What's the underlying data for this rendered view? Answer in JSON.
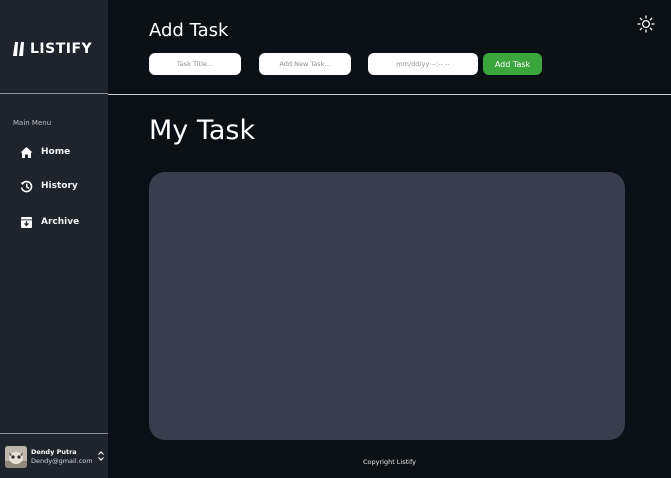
{
  "app": {
    "logo_text": "LISTIFY",
    "logo_mark_icon": "listify-quote-icon"
  },
  "sidebar": {
    "heading": "Main Menu",
    "items": [
      {
        "label": "Home",
        "icon": "home-icon"
      },
      {
        "label": "History",
        "icon": "history-icon"
      },
      {
        "label": "Archive",
        "icon": "archive-icon"
      }
    ]
  },
  "user": {
    "name": "Dendy Putra",
    "email": "Dendy@gmail.com",
    "toggle_icon": "chevron-up-down-icon"
  },
  "header": {
    "title": "Add Task",
    "theme_icon": "sun-icon",
    "task_title_placeholder": "Task Title...",
    "new_task_placeholder": "Add New Task...",
    "date_placeholder": "mm/dd/yy --:-- --",
    "add_button_label": "Add Task"
  },
  "main": {
    "title": "My Task"
  },
  "footer": {
    "text": "Copyright Listify"
  },
  "colors": {
    "page_bg": "#0b0f16",
    "sidebar_bg": "#1f232c",
    "panel_bg": "#383e4e",
    "accent_green": "#3aa63b"
  }
}
